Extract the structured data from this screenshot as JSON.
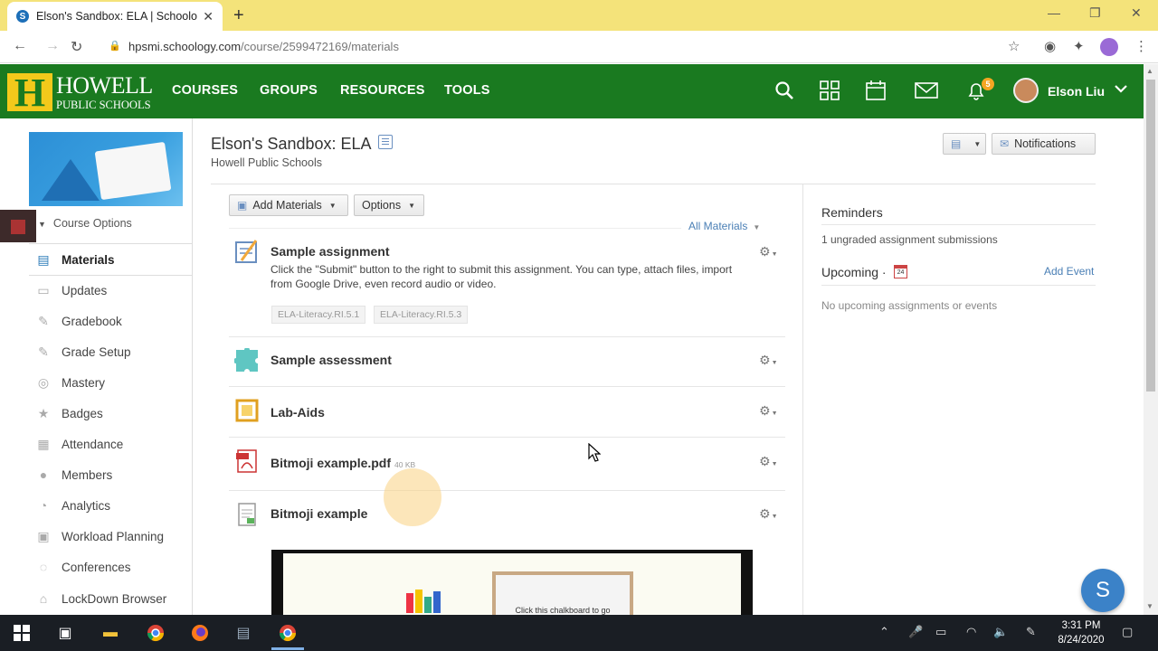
{
  "browser": {
    "tab_title": "Elson's Sandbox: ELA | Schoology",
    "favicon_letter": "S",
    "url_host": "hpsmi.schoology.com",
    "url_path": "/course/2599472169/materials"
  },
  "header": {
    "logo_letter": "H",
    "logo_line1": "HOWELL",
    "logo_line2": "PUBLIC SCHOOLS",
    "nav": [
      "COURSES",
      "GROUPS",
      "RESOURCES",
      "TOOLS"
    ],
    "notif_count": "5",
    "user_name": "Elson Liu"
  },
  "sidebar": {
    "course_options": "Course Options",
    "items": [
      {
        "label": "Materials",
        "icon": "materials-icon",
        "active": true
      },
      {
        "label": "Updates",
        "icon": "updates-icon"
      },
      {
        "label": "Gradebook",
        "icon": "gradebook-icon"
      },
      {
        "label": "Grade Setup",
        "icon": "grade-setup-icon"
      },
      {
        "label": "Mastery",
        "icon": "mastery-icon"
      },
      {
        "label": "Badges",
        "icon": "badges-icon"
      },
      {
        "label": "Attendance",
        "icon": "attendance-icon"
      },
      {
        "label": "Members",
        "icon": "members-icon"
      },
      {
        "label": "Analytics",
        "icon": "analytics-icon"
      },
      {
        "label": "Workload Planning",
        "icon": "workload-icon"
      },
      {
        "label": "Conferences",
        "icon": "conferences-icon"
      },
      {
        "label": "LockDown Browser",
        "icon": "lockdown-icon"
      }
    ]
  },
  "main": {
    "course_title": "Elson's Sandbox: ELA",
    "course_school": "Howell Public Schools",
    "notifications_label": "Notifications",
    "add_materials_label": "Add Materials",
    "options_label": "Options",
    "all_materials_label": "All Materials",
    "materials": [
      {
        "title": "Sample assignment",
        "description": "Click the \"Submit\" button to the right to submit this assignment. You can type, attach files, import from Google Drive, even record audio or video.",
        "tags": [
          "ELA-Literacy.RI.5.1",
          "ELA-Literacy.RI.5.3"
        ]
      },
      {
        "title": "Sample assessment"
      },
      {
        "title": "Lab-Aids"
      },
      {
        "title": "Bitmoji example.pdf",
        "size": "40 KB"
      },
      {
        "title": "Bitmoji example"
      }
    ],
    "embed_text": "Click this chalkboard to go"
  },
  "right_panel": {
    "reminders_title": "Reminders",
    "reminder_item": "1 ungraded assignment submissions",
    "upcoming_title": "Upcoming",
    "calendar_day": "24",
    "add_event": "Add Event",
    "no_upcoming": "No upcoming assignments or events"
  },
  "chat_bubble_letter": "S",
  "taskbar": {
    "time": "3:31 PM",
    "date": "8/24/2020"
  },
  "colors": {
    "brand_green": "#1a7a20",
    "brand_yellow": "#f3c91b",
    "link_blue": "#4a7fb5"
  }
}
